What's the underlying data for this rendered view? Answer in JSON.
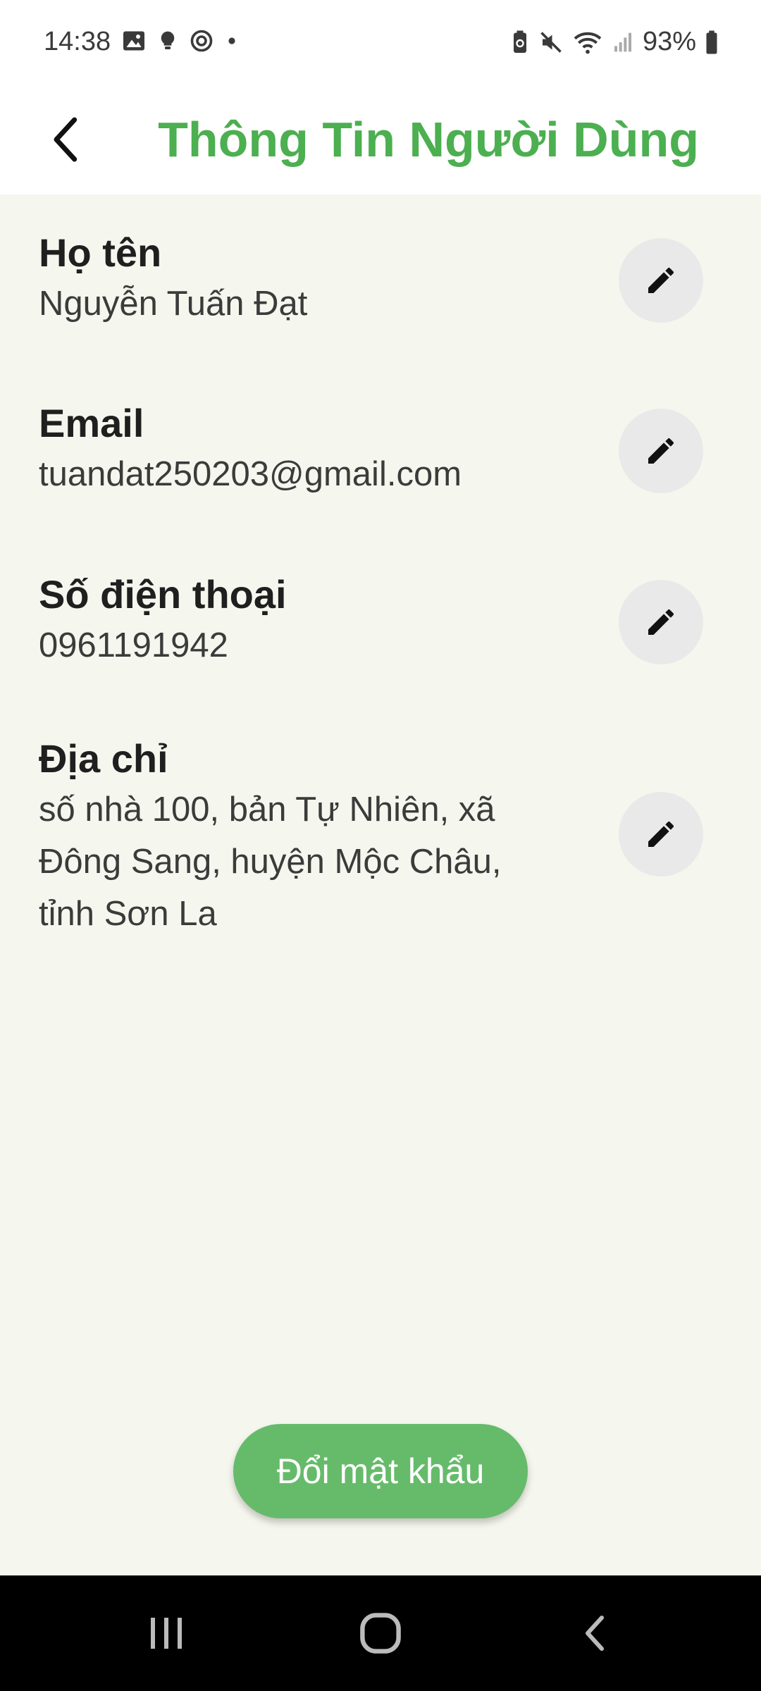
{
  "status_bar": {
    "time": "14:38",
    "battery": "93%",
    "left_icons": [
      "image-icon",
      "bulb-icon",
      "sync-icon",
      "dot-icon"
    ],
    "right_icons": [
      "battery-saver-icon",
      "mute-icon",
      "wifi-icon",
      "signal-icon",
      "battery-icon"
    ]
  },
  "header": {
    "title": "Thông Tin Người Dùng",
    "back_icon": "chevron-left-icon"
  },
  "fields": [
    {
      "label": "Họ tên",
      "value": "Nguyễn Tuấn Đạt",
      "edit_icon": "pencil-icon"
    },
    {
      "label": "Email",
      "value": "tuandat250203@gmail.com",
      "edit_icon": "pencil-icon"
    },
    {
      "label": "Số điện thoại",
      "value": "0961191942",
      "edit_icon": "pencil-icon"
    },
    {
      "label": "Địa chỉ",
      "value": "số nhà 100, bản Tự Nhiên, xã Đông Sang, huyện Mộc Châu, tỉnh Sơn La",
      "edit_icon": "pencil-icon"
    }
  ],
  "change_password": {
    "label": "Đổi mật khẩu"
  },
  "nav_bar": {
    "icons": [
      "recents-icon",
      "home-icon",
      "back-icon"
    ]
  },
  "colors": {
    "accent": "#4caf50",
    "button": "#66bb6a",
    "background": "#f5f7ee",
    "edit_button_bg": "#e9e9e9"
  }
}
